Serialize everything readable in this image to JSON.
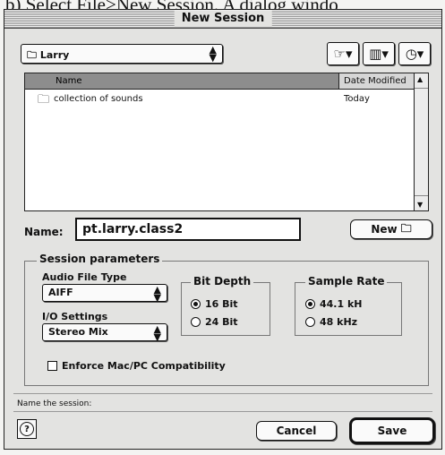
{
  "caption": "b) Select File>New Session. A dialog windo",
  "window": {
    "title": "New Session"
  },
  "location": {
    "folder": "Larry"
  },
  "toolbar": {
    "shortcuts_icon": "shortcuts-icon",
    "favorites_icon": "favorites-icon",
    "recent_icon": "recent-icon"
  },
  "file_list": {
    "columns": [
      "Name",
      "Date Modified"
    ],
    "rows": [
      {
        "name": "collection of sounds",
        "date": "Today",
        "icon": "folder-icon"
      }
    ]
  },
  "name_field": {
    "label": "Name:",
    "value": "pt.larry.class2"
  },
  "new_folder_button": {
    "label": "New"
  },
  "session_parameters": {
    "title": "Session parameters",
    "audio_file_type": {
      "label": "Audio File Type",
      "value": "AIFF"
    },
    "io_settings": {
      "label": "I/O Settings",
      "value": "Stereo Mix"
    },
    "bit_depth": {
      "title": "Bit Depth",
      "options": [
        {
          "label": "16 Bit",
          "selected": true
        },
        {
          "label": "24 Bit",
          "selected": false
        }
      ]
    },
    "sample_rate": {
      "title": "Sample Rate",
      "options": [
        {
          "label": "44.1 kH",
          "selected": true
        },
        {
          "label": "48 kHz",
          "selected": false
        }
      ]
    },
    "compatibility": {
      "label": "Enforce Mac/PC Compatibility",
      "checked": false
    }
  },
  "status_text": "Name the session:",
  "buttons": {
    "cancel": "Cancel",
    "save": "Save",
    "help": "?"
  }
}
